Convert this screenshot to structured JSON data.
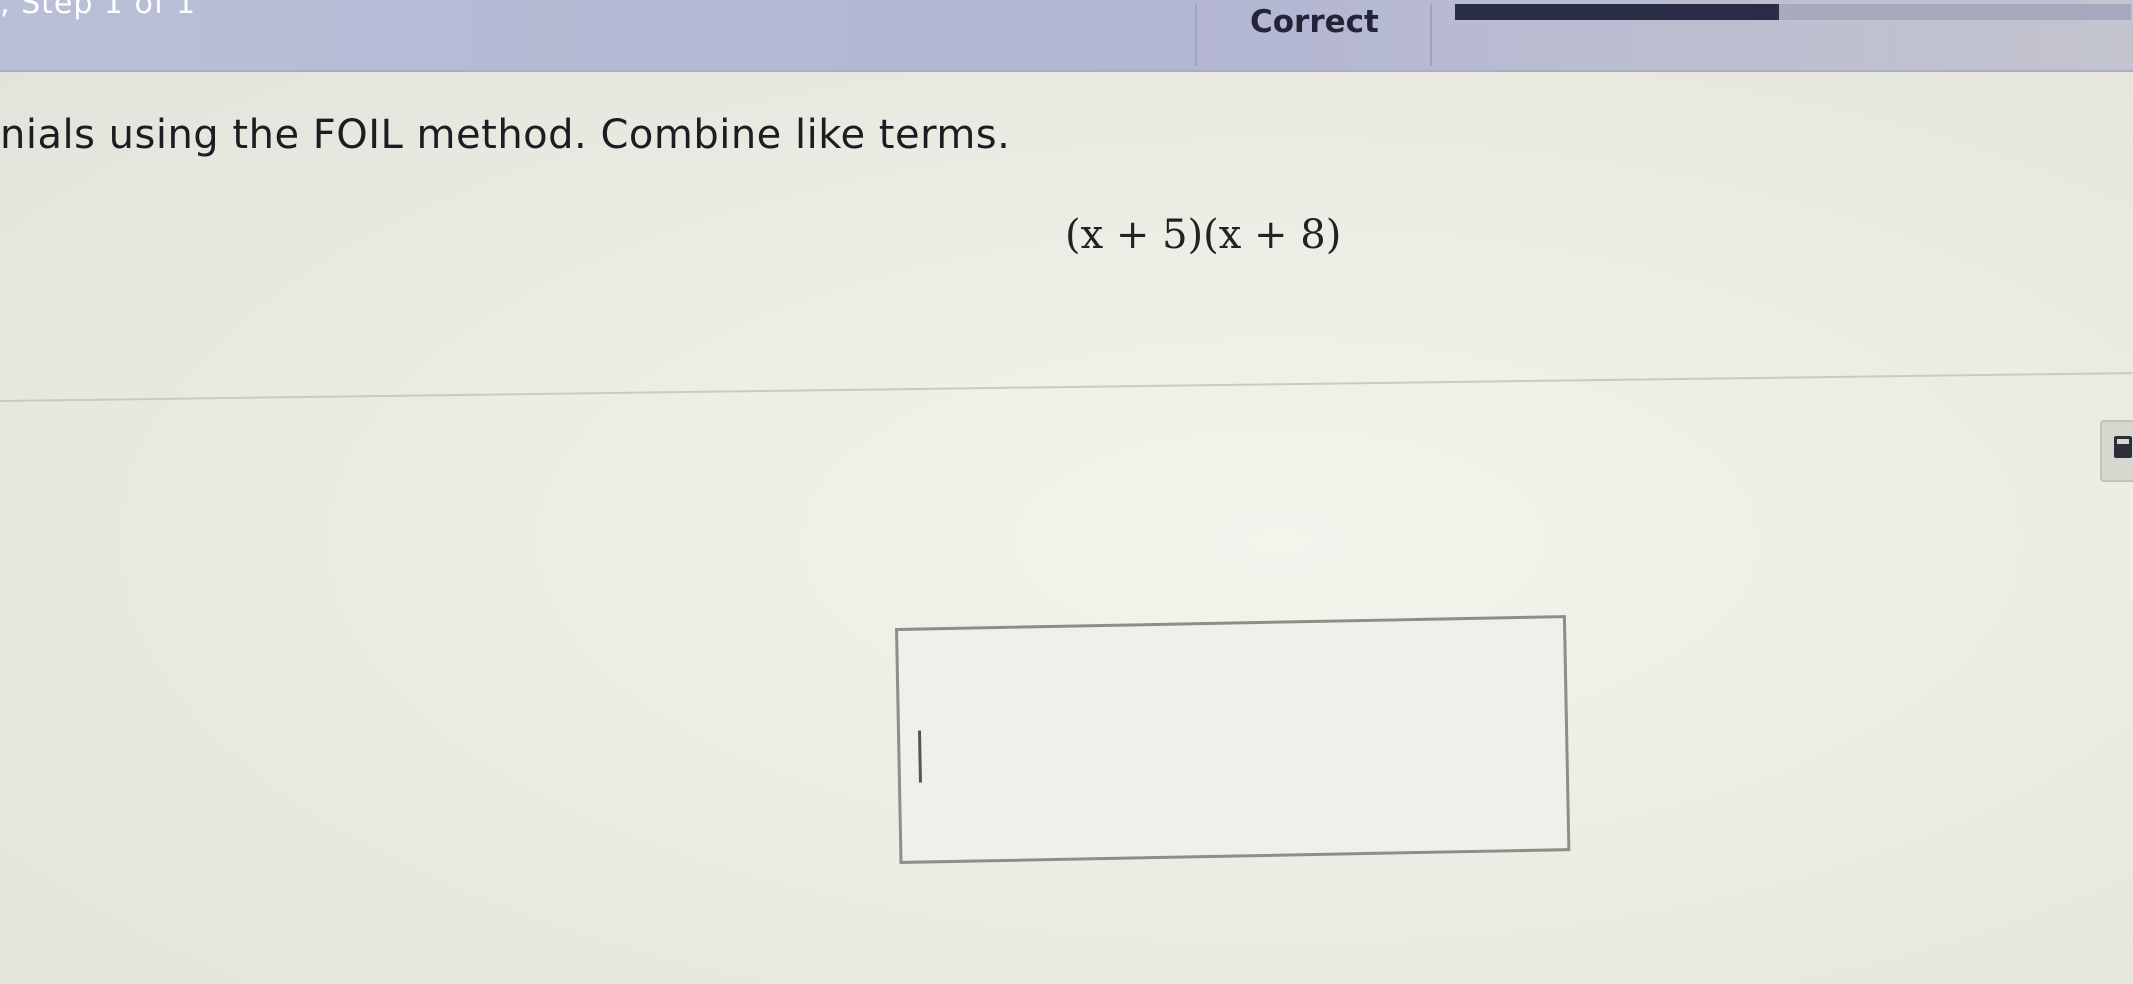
{
  "header": {
    "step_label": ", Step 1 of 1",
    "status": "Correct",
    "progress": 0.48
  },
  "question": {
    "instructions": "nials using the FOIL method. Combine like terms.",
    "expression": "(x + 5)(x + 8)"
  },
  "answer": {
    "value": ""
  },
  "tools": {
    "calculator_icon": "calculator-icon"
  },
  "colors": {
    "topbar": "#b3b6d3",
    "progress_fill": "#2a2d48"
  }
}
